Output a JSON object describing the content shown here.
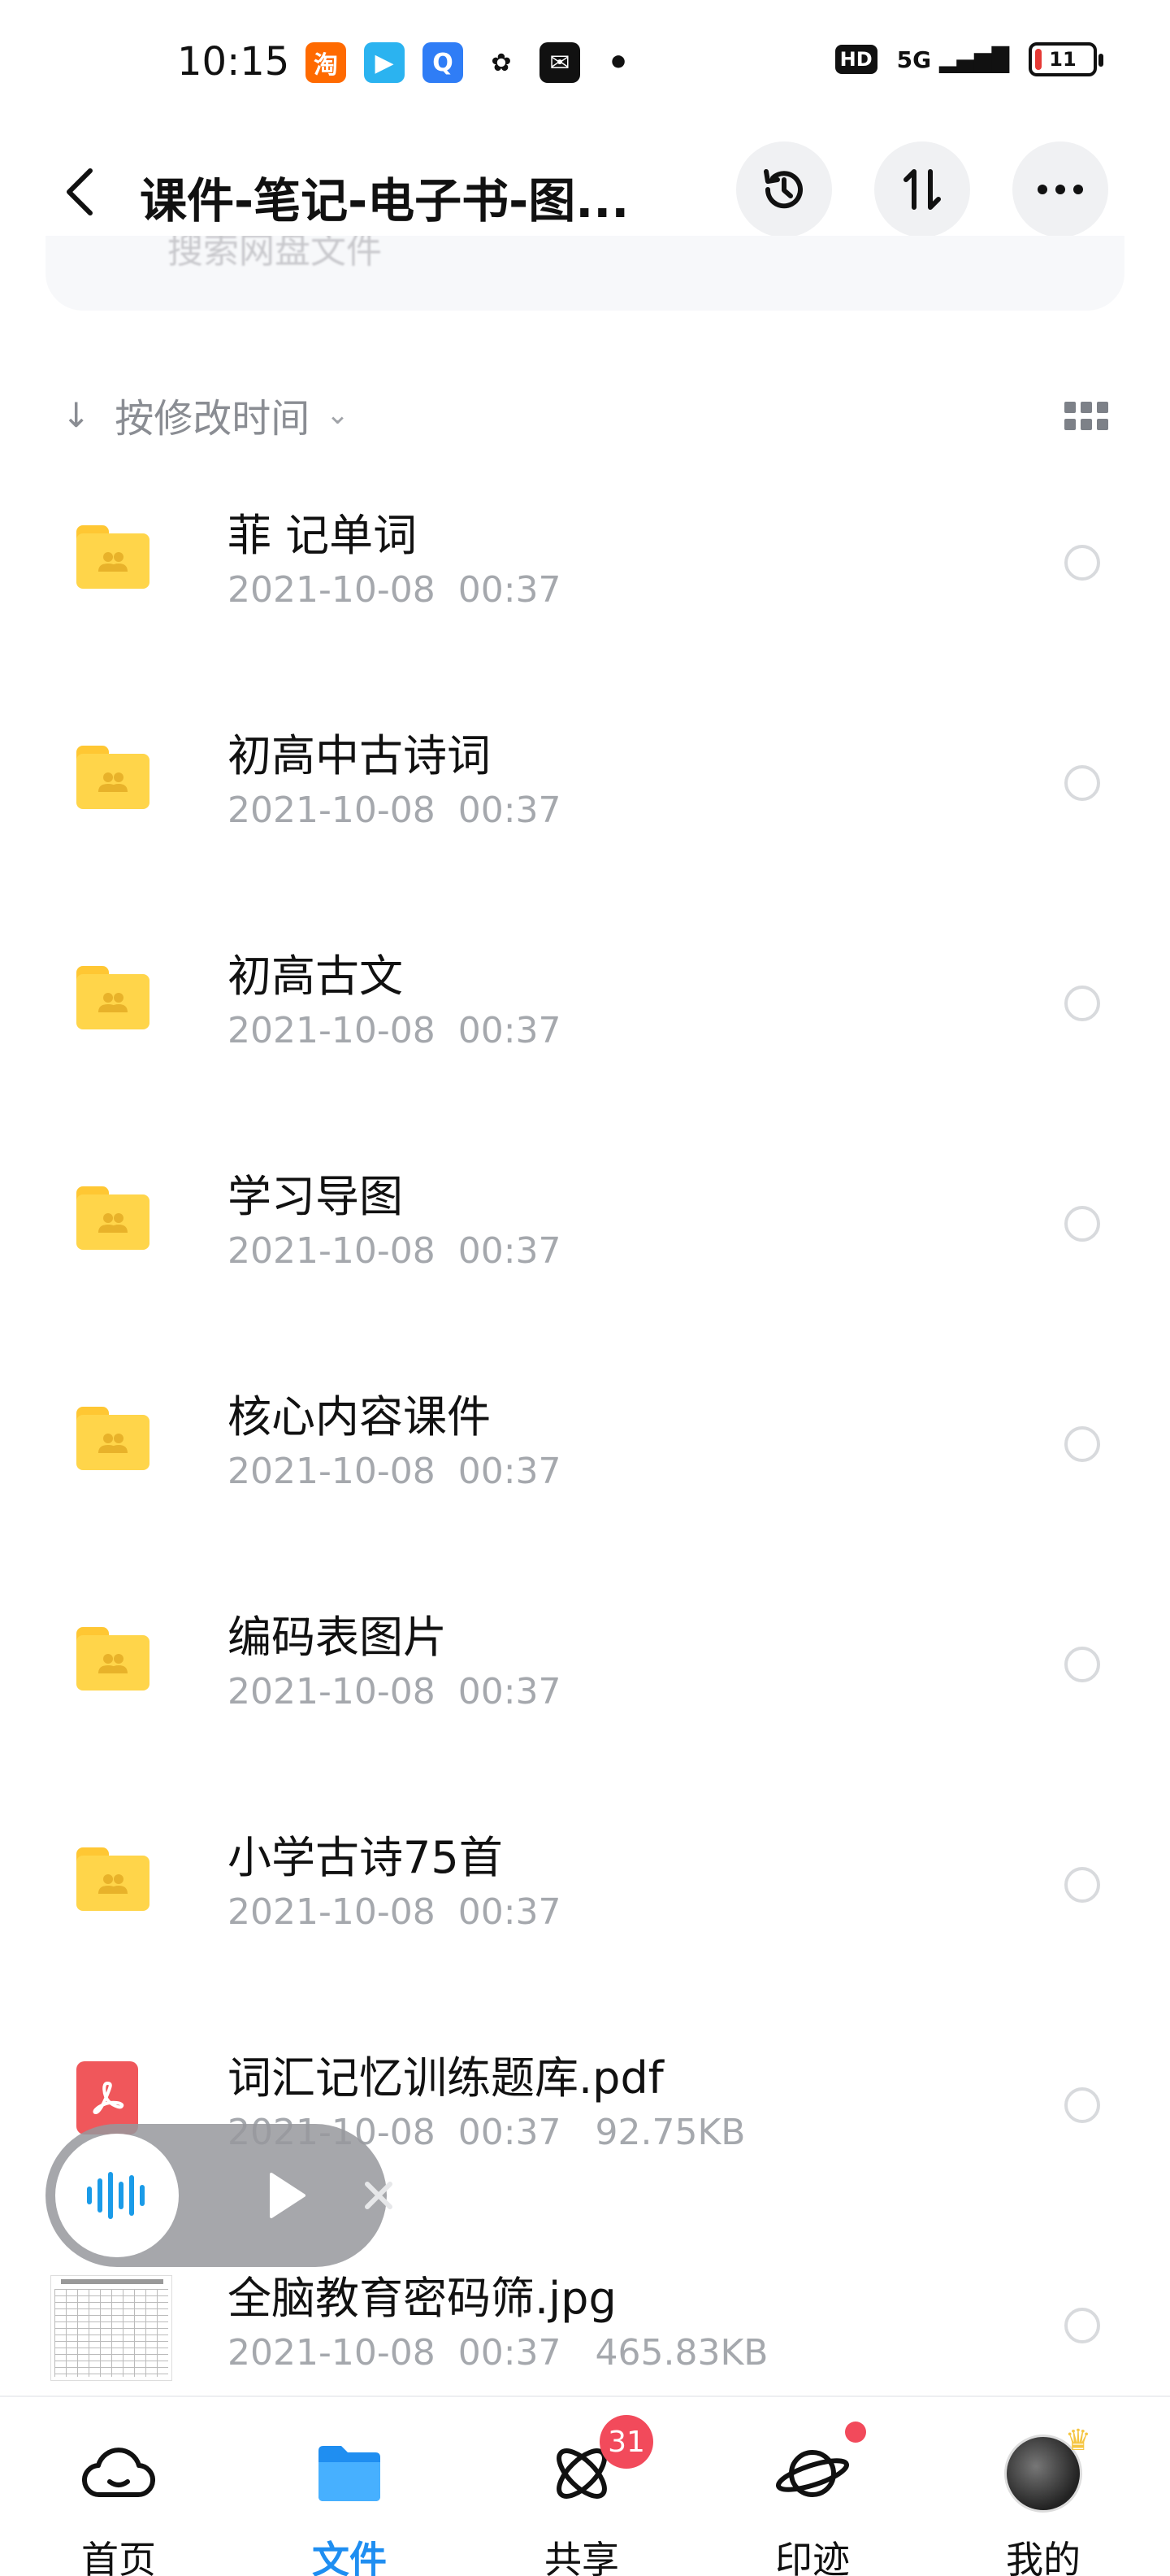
{
  "status_bar": {
    "time": "10:15",
    "apps": [
      {
        "icon": "taobao-icon",
        "glyph": "淘",
        "color": "#ff6a00"
      },
      {
        "icon": "video-play-icon",
        "glyph": "▶",
        "color": "#2bb3f0"
      },
      {
        "icon": "browser-icon",
        "glyph": "Q",
        "color": "#2f7df6"
      },
      {
        "icon": "squirrel-app-icon",
        "glyph": "✿",
        "color": "#111111"
      },
      {
        "icon": "mail-icon",
        "glyph": "✉",
        "color": "#111111"
      },
      {
        "icon": "more-notifications-dot",
        "glyph": "•",
        "color": "#111111"
      }
    ],
    "hd": "HD",
    "network": "5G",
    "battery": "11"
  },
  "header": {
    "title": "课件-笔记-电子书-图...",
    "back_icon": "back-arrow-icon",
    "history_icon": "history-icon",
    "sort_icon": "sort-toggle-icon",
    "more_icon": "more-icon"
  },
  "search": {
    "placeholder": "搜索网盘文件"
  },
  "sort": {
    "label": "按修改时间",
    "arrow": "↓",
    "chevron": "⌄"
  },
  "files": [
    {
      "type": "folder",
      "name": "菲  记单词",
      "date": "2021-10-08",
      "time": "00:37",
      "size": ""
    },
    {
      "type": "folder",
      "name": "初高中古诗词",
      "date": "2021-10-08",
      "time": "00:37",
      "size": ""
    },
    {
      "type": "folder",
      "name": "初高古文",
      "date": "2021-10-08",
      "time": "00:37",
      "size": ""
    },
    {
      "type": "folder",
      "name": "学习导图",
      "date": "2021-10-08",
      "time": "00:37",
      "size": ""
    },
    {
      "type": "folder",
      "name": "核心内容课件",
      "date": "2021-10-08",
      "time": "00:37",
      "size": ""
    },
    {
      "type": "folder",
      "name": "编码表图片",
      "date": "2021-10-08",
      "time": "00:37",
      "size": ""
    },
    {
      "type": "folder",
      "name": "小学古诗75首",
      "date": "2021-10-08",
      "time": "00:37",
      "size": ""
    },
    {
      "type": "pdf",
      "name": "词汇记忆训练题库.pdf",
      "date": "2021-10-08",
      "time": "00:37",
      "size": "92.75KB"
    },
    {
      "type": "jpg",
      "name": "全脑教育密码筛.jpg",
      "date": "2021-10-08",
      "time": "00:37",
      "size": "465.83KB"
    }
  ],
  "player": {
    "wave_icon": "audio-wave-icon",
    "play_icon": "play-icon",
    "close_icon": "close-icon"
  },
  "bottom_nav": {
    "items": [
      {
        "label": "首页",
        "icon": "home-cloud-icon",
        "active": false,
        "badge": "",
        "dot": false
      },
      {
        "label": "文件",
        "icon": "folder-icon",
        "active": true,
        "badge": "",
        "dot": false
      },
      {
        "label": "共享",
        "icon": "share-atom-icon",
        "active": false,
        "badge": "31",
        "dot": false
      },
      {
        "label": "印迹",
        "icon": "planet-icon",
        "active": false,
        "badge": "",
        "dot": true
      },
      {
        "label": "我的",
        "icon": "avatar",
        "active": false,
        "badge": "",
        "dot": false
      }
    ],
    "active_color": "#1f8ef1",
    "badge_color": "#f24a5b"
  }
}
